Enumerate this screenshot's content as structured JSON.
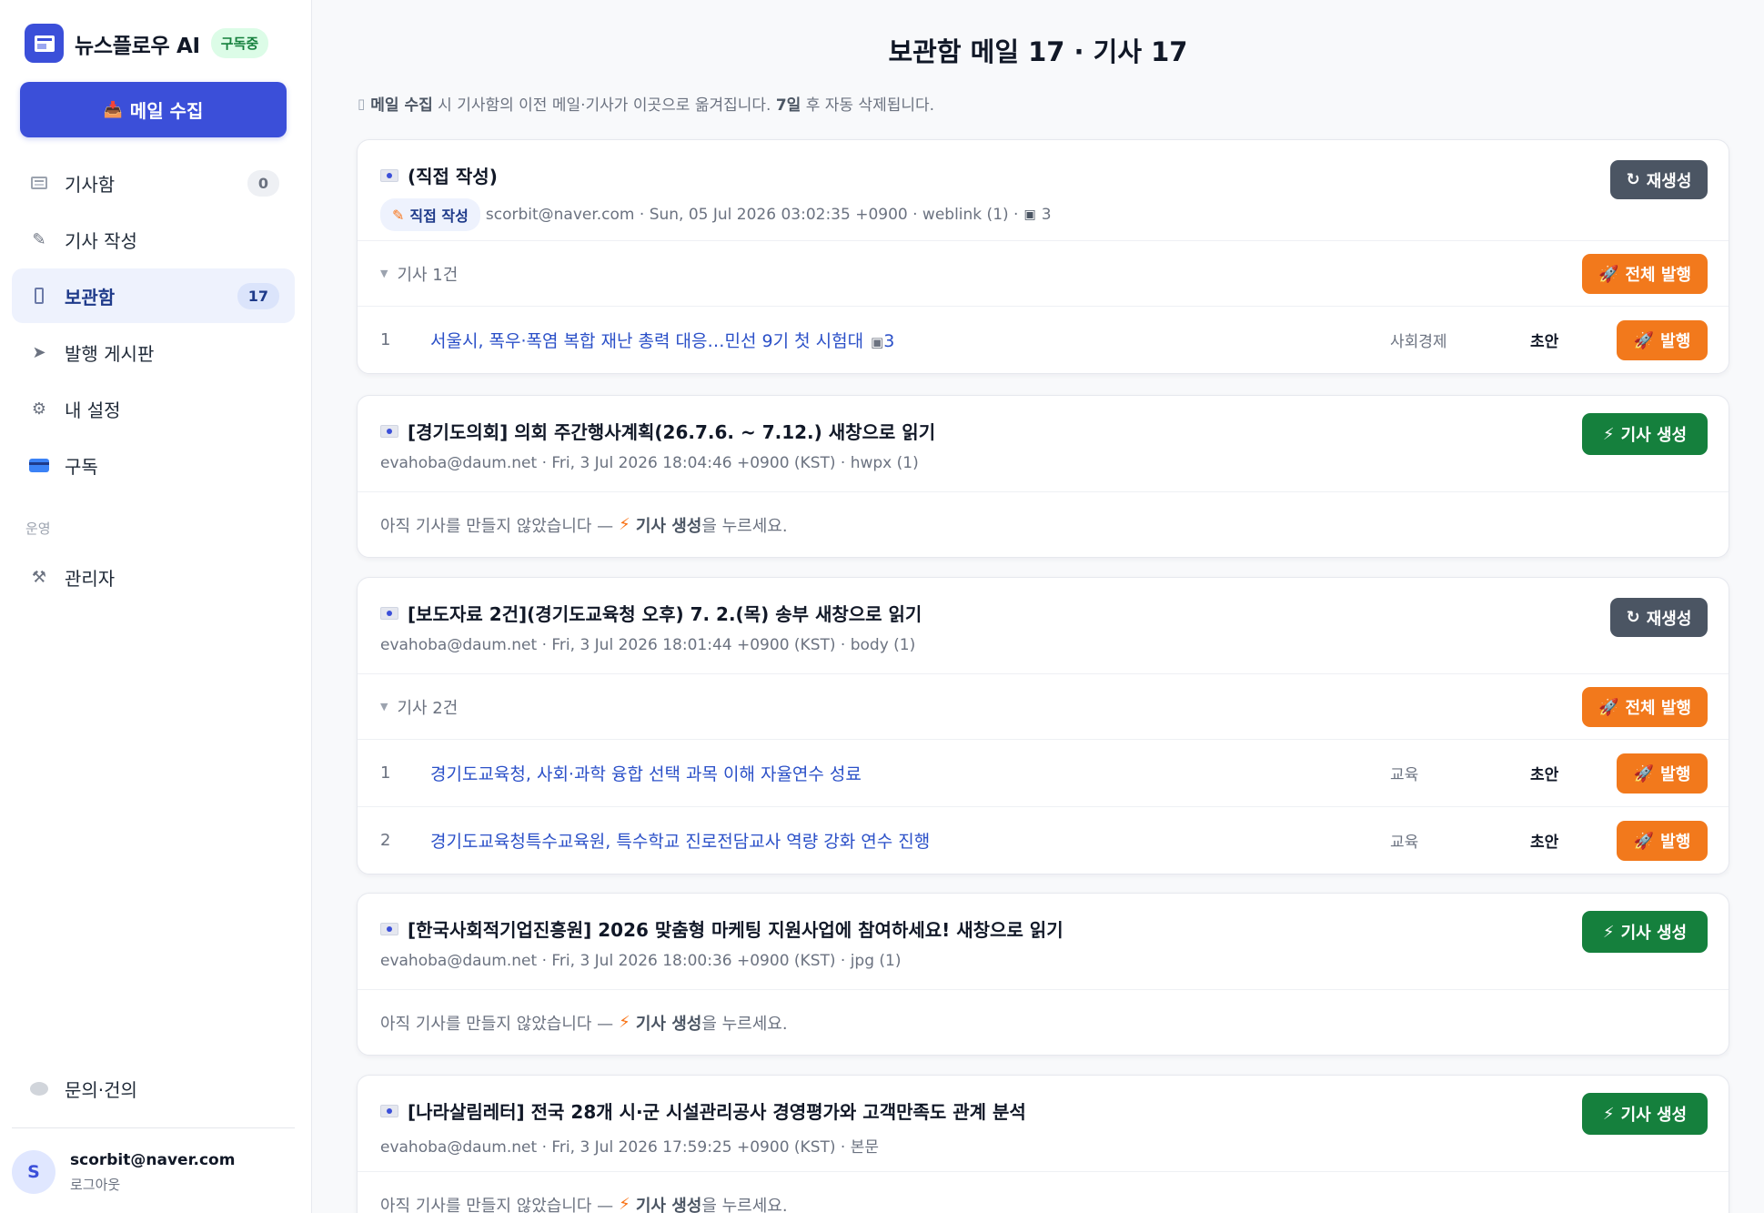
{
  "sidebar": {
    "brand_name": "뉴스플로우 AI",
    "subscription_badge": "구독중",
    "collect_button": "메일 수집",
    "items": [
      {
        "label": "기사함",
        "count": "0"
      },
      {
        "label": "기사 작성"
      },
      {
        "label": "보관함",
        "count": "17"
      },
      {
        "label": "발행 게시판"
      },
      {
        "label": "내 설정"
      },
      {
        "label": "구독"
      }
    ],
    "section_label": "운영",
    "admin_label": "관리자",
    "feedback_label": "문의·건의",
    "user_email": "scorbit@naver.com",
    "avatar_initial": "S",
    "logout_label": "로그아웃"
  },
  "main": {
    "title": "보관함 메일 17 · 기사 17",
    "notice": {
      "bold1": "메일 수집",
      "text1": " 시 기사함의 이전 메일·기사가 이곳으로 옮겨집니다. ",
      "bold2": "7일",
      "text2": " 후 자동 삭제됩니다."
    },
    "labels": {
      "regenerate": "재생성",
      "generate": "기사 생성",
      "publish_all": "전체 발행",
      "publish": "발행",
      "empty_prefix": "아직 기사를 만들지 않았습니다 — ",
      "empty_bold": "기사 생성",
      "empty_suffix": "을 누르세요."
    },
    "mails": [
      {
        "title": "(직접 작성)",
        "direct_chip": "직접 작성",
        "meta": "scorbit@naver.com · Sun, 05 Jul 2026 03:02:35 +0900 · weblink (1) ·",
        "photo_count": "3",
        "articles_label": "기사 1건",
        "articles": [
          {
            "no": "1",
            "title": "서울시, 폭우·폭염 복합 재난 총력 대응…민선 9기 첫 시험대",
            "photos": "3",
            "category": "사회경제",
            "status": "초안"
          }
        ]
      },
      {
        "title": "[경기도의회] 의회 주간행사계획(26.7.6. ~ 7.12.) 새창으로 읽기",
        "meta": "evahoba@daum.net · Fri, 3 Jul 2026 18:04:46 +0900 (KST) · hwpx (1)"
      },
      {
        "title": "[보도자료 2건](경기도교육청 오후) 7. 2.(목) 송부 새창으로 읽기",
        "meta": "evahoba@daum.net · Fri, 3 Jul 2026 18:01:44 +0900 (KST) · body (1)",
        "articles_label": "기사 2건",
        "articles": [
          {
            "no": "1",
            "title": "경기도교육청, 사회·과학 융합 선택 과목 이해 자율연수 성료",
            "category": "교육",
            "status": "초안"
          },
          {
            "no": "2",
            "title": "경기도교육청특수교육원, 특수학교 진로전담교사 역량 강화 연수 진행",
            "category": "교육",
            "status": "초안"
          }
        ]
      },
      {
        "title": "[한국사회적기업진흥원] 2026 맞춤형 마케팅 지원사업에 참여하세요! 새창으로 읽기",
        "meta": "evahoba@daum.net · Fri, 3 Jul 2026 18:00:36 +0900 (KST) · jpg (1)"
      },
      {
        "title": "[나라살림레터] 전국 28개 시·군 시설관리공사 경영평가와 고객만족도 관계 분석",
        "meta": "evahoba@daum.net · Fri, 3 Jul 2026 17:59:25 +0900 (KST) · 본문"
      }
    ]
  },
  "colors": {
    "accent": "#3b4fd9",
    "generate_green": "#15803d",
    "publish_orange": "#f2791c",
    "regenerate_gray": "#4b5563",
    "link_blue": "#2b50c8"
  },
  "icons": {
    "brand": "newspaper-icon",
    "collect": "inbox-tray-icon",
    "regenerate": "refresh-icon",
    "generate": "bolt-icon",
    "publish": "rocket-icon",
    "photo": "camera-icon"
  }
}
